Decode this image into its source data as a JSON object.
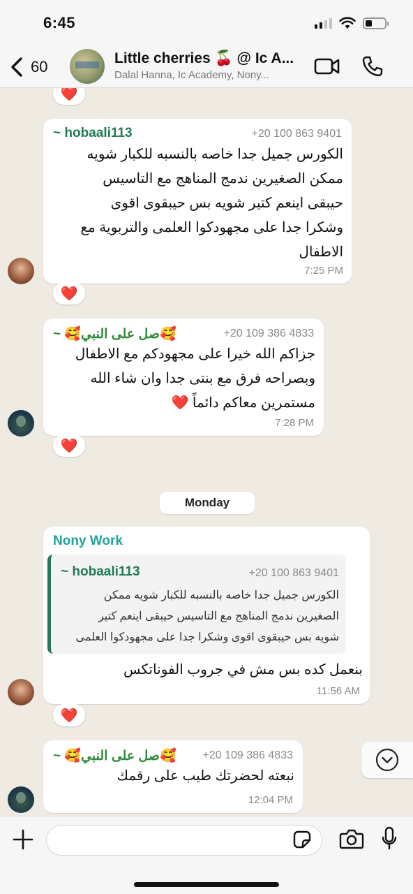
{
  "status_bar": {
    "time": "6:45"
  },
  "header": {
    "back_count": "60",
    "title": "Little cherries 🍒 @ Ic A...",
    "subtitle": "Dalal Hanna, Ic Academy, Nony..."
  },
  "reactions": {
    "heart": "❤️"
  },
  "messages": [
    {
      "sender": "~ hobaali113",
      "phone": "+20 100 863 9401",
      "lines": [
        "الكورس جميل جدا خاصه بالنسبه للكبار شويه",
        "ممكن الصغيرين ندمج المناهج مع التاسيس",
        "حيبقى اينعم كتير شويه بس حيبقوى اقوى",
        "وشكرا جدا على مجهودكوا العلمى والتربوية مع",
        "الاطفال"
      ],
      "time": "7:25 PM",
      "sender_color": "#1f7a55"
    },
    {
      "sender": "~ 🥰صل على النبي🥰",
      "phone": "+20 109 386 4833",
      "lines": [
        "جزاكم الله خيرا على مجهودكم مع الاطفال",
        "وبصراحه فرق مع بنتى جدا وان شاء الله",
        "مستمرين معاكم دائماً ❤️"
      ],
      "time": "7:28 PM",
      "sender_color": "#2e8b3a"
    },
    {
      "day_chip": "Monday"
    },
    {
      "sender": "Nony Work",
      "quote": {
        "sender": "~ hobaali113",
        "phone": "+20 100 863 9401",
        "lines": [
          "الكورس جميل جدا خاصه بالنسبه للكبار شويه ممكن",
          "الصغيرين ندمج المناهج مع التاسيس حيبقى اينعم كتير",
          "شويه بس حيبقوى اقوى وشكرا جدا على مجهودكوا العلمى"
        ]
      },
      "text": "بنعمل كده بس مش في جروب الفوناتكس",
      "time": "11:56 AM",
      "sender_color": "#1fa39a"
    },
    {
      "sender": "~ 🥰صل على النبي🥰",
      "phone": "+20 109 386 4833",
      "text": "نبعته لحضرتك طيب على رقمك",
      "time": "12:04 PM",
      "sender_color": "#2e8b3a"
    }
  ],
  "input": {
    "value": "",
    "placeholder": ""
  }
}
